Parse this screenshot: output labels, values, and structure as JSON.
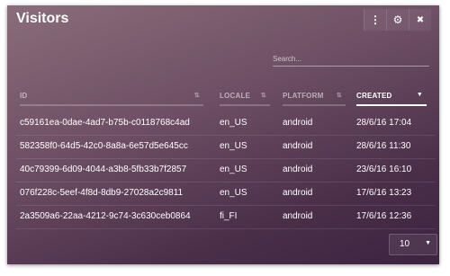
{
  "window": {
    "title": "Visitors",
    "buttons": [
      {
        "name": "more",
        "icon": "more-vertical-icon",
        "glyph": "⋮"
      },
      {
        "name": "settings",
        "icon": "gear-icon",
        "glyph": "⚙"
      },
      {
        "name": "close",
        "icon": "close-icon",
        "glyph": "✖"
      }
    ]
  },
  "search": {
    "placeholder": "Search...",
    "value": ""
  },
  "table": {
    "columns": [
      {
        "label": "ID",
        "sort_icon": "sort-icon",
        "sort_glyph": "⇅",
        "active": false
      },
      {
        "label": "LOCALE",
        "sort_icon": "sort-icon",
        "sort_glyph": "⇅",
        "active": false
      },
      {
        "label": "PLATFORM",
        "sort_icon": "sort-icon",
        "sort_glyph": "⇅",
        "active": false
      },
      {
        "label": "CREATED",
        "sort_icon": "sort-desc-icon",
        "sort_glyph": "▼",
        "active": true
      }
    ],
    "rows": [
      {
        "id": "c59161ea-0dae-4ad7-b75b-c0118768c4ad",
        "locale": "en_US",
        "platform": "android",
        "created": "28/6/16 17:04"
      },
      {
        "id": "582358f0-64d5-42c0-8a8a-6e57d5e645cc",
        "locale": "en_US",
        "platform": "android",
        "created": "28/6/16 11:30"
      },
      {
        "id": "40c79399-6d09-4044-a3b8-5fb33b7f2857",
        "locale": "en_US",
        "platform": "android",
        "created": "23/6/16 16:10"
      },
      {
        "id": "076f228c-5eef-4f8d-8db9-27028a2c9811",
        "locale": "en_US",
        "platform": "android",
        "created": "17/6/16 13:23"
      },
      {
        "id": "2a3509a6-22aa-4212-9c74-3c630ceb0864",
        "locale": "fi_FI",
        "platform": "android",
        "created": "17/6/16 12:36"
      }
    ]
  },
  "pagination": {
    "page_size": "10",
    "caret_glyph": "▼"
  },
  "colors": {
    "header_text": "#ffffff",
    "panel_gradient_start": "#8a6d7a",
    "panel_gradient_end": "#3c2340"
  }
}
